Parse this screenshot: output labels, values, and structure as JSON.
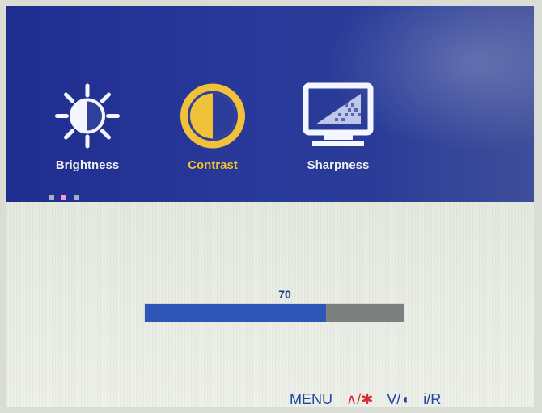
{
  "menu": {
    "items": [
      {
        "label": "Brightness",
        "icon": "brightness-icon",
        "active": false
      },
      {
        "label": "Contrast",
        "icon": "contrast-icon",
        "active": true
      },
      {
        "label": "Sharpness",
        "icon": "sharpness-icon",
        "active": false
      }
    ],
    "page_dots": [
      "#a6aec4",
      "#f19ad8",
      "#a6aec4"
    ]
  },
  "slider": {
    "value": "70",
    "percent": 70
  },
  "hints": {
    "menu": "MENU",
    "up_action": "∧/✱",
    "down_action": "V/◖",
    "info": "i/R"
  },
  "colors": {
    "active": "#f0c23a",
    "bar_fill": "#2d56b6",
    "bar_empty": "#7c7f7d",
    "hint_blue": "#1d43a5",
    "hint_red": "#d92d35"
  }
}
